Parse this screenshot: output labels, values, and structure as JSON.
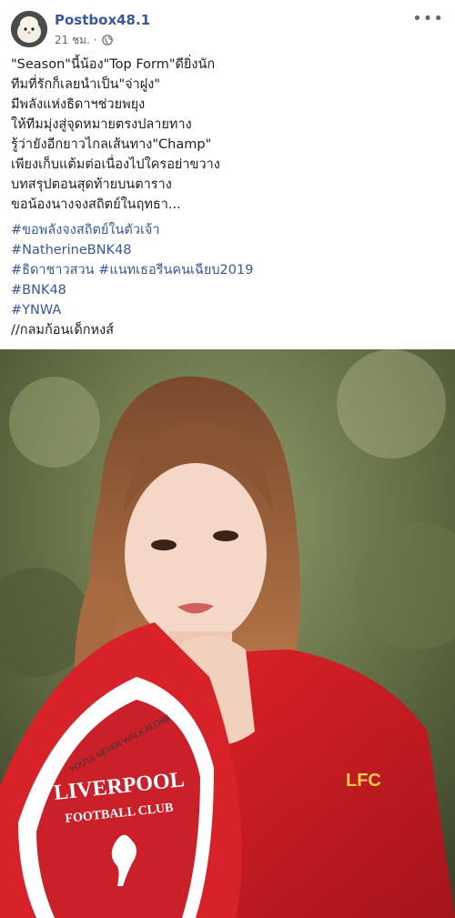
{
  "post": {
    "author": "Postbox48.1",
    "time": "21 ชม.",
    "separator": "·",
    "privacy_icon": "globe-icon",
    "more_icon": "more-options-icon",
    "more_symbol": "•••",
    "lines": [
      "\"Season\"นี้น้อง\"Top Form\"ดียิ่งนัก",
      "ทีมที่รักก็เลยนำเป็น\"จ่าฝูง\"",
      "มีพลังแห่งธิดาฯช่วยพยุง",
      "ให้ทีมมุ่งสู่จุดหมายตรงปลายทาง",
      "รู้ว่ายังอีกยาวไกลเส้นทาง\"Champ\"",
      "เพียงเก็บแต้มต่อเนื่องไปใครอย่าขวาง",
      "บทสรุปตอนสุดท้ายบนตาราง",
      "ขอน้องนางจงสถิตย์ในฤทธา..."
    ],
    "hashtags": [
      "#ขอพลังจงสถิตย์ในตัวเจ้า",
      "#NatherineBNK48",
      "#ธิดาชาวสวน #แนทเธอรีนคนเฉียบ2019",
      "#BNK48",
      "#YNWA"
    ],
    "footer_line": "//กลมก้อนเด็กหงส์",
    "photo": {
      "crest_line1": "LIVERPOOL",
      "crest_line2": "FOOTBALL CLUB",
      "crest_arc": "YOU'LL NEVER WALK ALONE",
      "shirt_text": "LFC"
    }
  }
}
